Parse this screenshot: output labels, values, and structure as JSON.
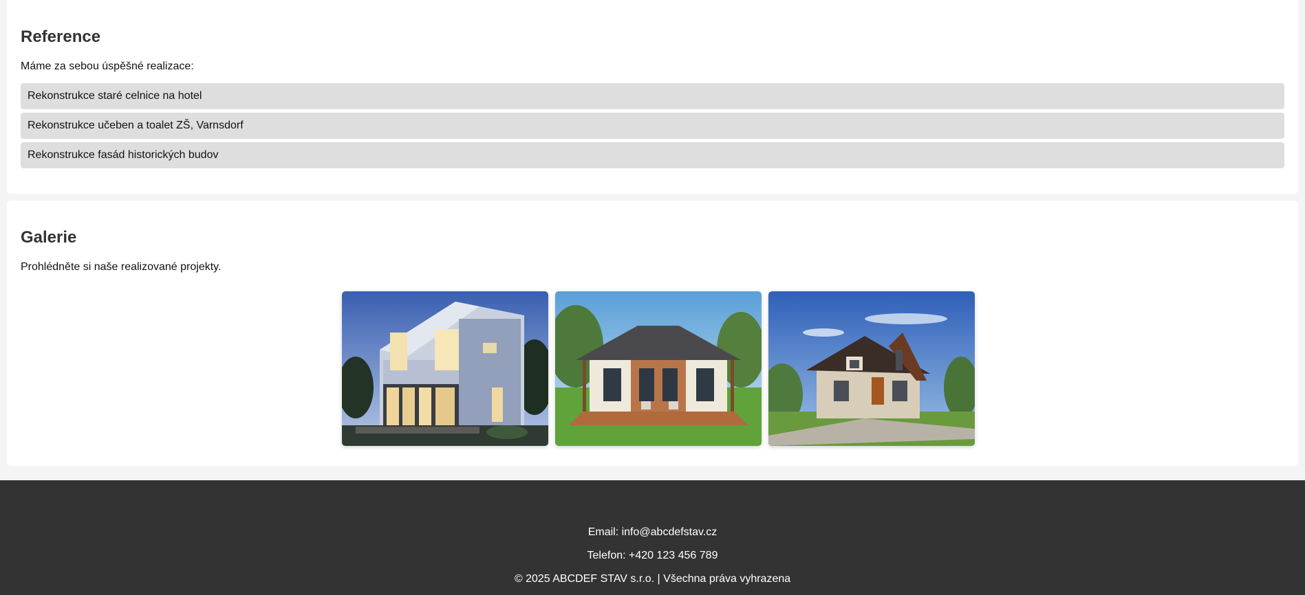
{
  "reference": {
    "title": "Reference",
    "intro": "Máme za sebou úspěšné realizace:",
    "items": [
      {
        "label": "Rekonstrukce staré celnice na hotel"
      },
      {
        "label": "Rekonstrukce učeben a toalet ZŠ, Varnsdorf"
      },
      {
        "label": "Rekonstrukce fasád historických budov"
      }
    ]
  },
  "gallery": {
    "title": "Galerie",
    "intro": "Prohlédněte si naše realizované projekty.",
    "photos": [
      {
        "subject": "modern-cube-house-dusk"
      },
      {
        "subject": "bungalow-with-terrace"
      },
      {
        "subject": "family-house-with-dormers"
      }
    ]
  },
  "footer": {
    "email": "Email: info@abcdefstav.cz",
    "phone": "Telefon: +420 123 456 789",
    "copyright": "© 2025 ABCDEF STAV s.r.o. | Všechna práva vyhrazena"
  },
  "colors": {
    "page_bg": "#f4f4f4",
    "card_bg": "#ffffff",
    "list_item_bg": "#dedede",
    "footer_bg": "#333333",
    "heading": "#333333"
  }
}
